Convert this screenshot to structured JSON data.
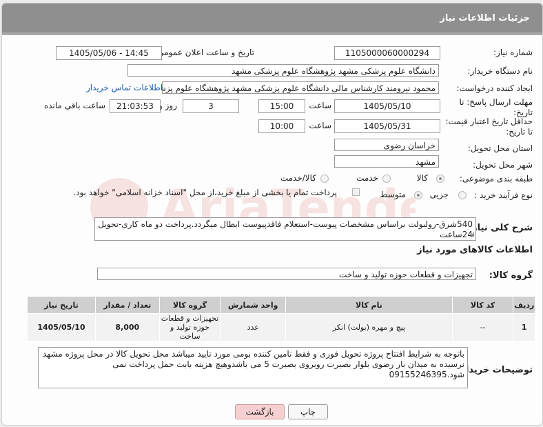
{
  "header": {
    "title": "جزئیات اطلاعات نیاز"
  },
  "fields": {
    "need_number_label": "شماره نیاز:",
    "need_number": "1105000060000294",
    "announce_label": "تاریخ و ساعت اعلان عمومی:",
    "announce_value": "1405/05/06 - 14:45",
    "buyer_org_label": "نام دستگاه خریدار:",
    "buyer_org": "دانشگاه علوم پزشکی مشهد   پژوهشگاه علوم پزشکی مشهد",
    "requester_label": "ایجاد کننده درخواست:",
    "requester": "محمود نیرومند کارشناس مالی دانشگاه علوم پزشکی مشهد   پژوهشگاه علوم پزشکی مشهد",
    "contact_link": "اطلاعات تماس خریدار",
    "deadline_label": "مهلت ارسال پاسخ: تا تاریخ:",
    "deadline_date": "1405/05/10",
    "time_label": "ساعت",
    "deadline_time": "15:00",
    "days_value": "3",
    "days_label": "روز و",
    "remaining_time": "21:03:53",
    "remaining_label": "ساعت باقی مانده",
    "validity_label": "حداقل تاریخ اعتبار قیمت: تا تاریخ:",
    "validity_date": "1405/05/31",
    "validity_time_label": "ساعت",
    "validity_time": "10:00",
    "province_label": "استان محل تحویل:",
    "province": "خراسان رضوی",
    "city_label": "شهر محل تحویل:",
    "city": "مشهد",
    "category_label": "طبقه بندی موضوعی:",
    "category_options": [
      "کالا",
      "خدمت",
      "کالا/خدمت"
    ],
    "category_selected": "کالا",
    "process_label": "نوع فرآیند خرید :",
    "process_options": [
      "جزیی",
      "متوسط"
    ],
    "process_selected": "جزیی",
    "payment_note": "پرداخت تمام یا بخشی از مبلغ خرید،از محل \"اسناد خزانه اسلامی\" خواهد بود."
  },
  "description": {
    "label": "شرح کلی نیاز:",
    "text": "540شرق-رولبولت براساس مشخصات پیوست-استعلام فاقدپیوست ابطال میگردد.پرداخت دو ماه کاری-تحویل 24ساعت"
  },
  "goods": {
    "section_title": "اطلاعات کالاهای مورد نیاز",
    "group_label": "گروه کالا:",
    "group_value": "تجهیزات و قطعات حوزه تولید و ساخت",
    "columns": [
      "ردیف",
      "کد کالا",
      "نام کالا",
      "واحد شمارش",
      "گروه کالا",
      "تعداد / مقدار",
      "تاریخ نیاز"
    ],
    "rows": [
      {
        "index": "1",
        "code": "--",
        "name": "پیچ و مهره (بولت) انکر",
        "unit": "عدد",
        "group": "تجهیزات و قطعات حوزه تولید و ساخت",
        "qty": "8,000",
        "date": "1405/05/10"
      }
    ]
  },
  "buyer_notes": {
    "label": "توضیحات خریدار:",
    "text": "باتوجه به شرایط افتتاح پروژه تحویل فوری و فقط تامین کننده بومی مورد تایید میباشد محل تحویل کالا در محل پروژه  مشهد نرسیده به میدان بار رضوی بلوار بصیرت روبروی بصیرت 5 می باشدوهیچ هزینه بابت حمل  پرداخت نمی شود.09155246395"
  },
  "buttons": {
    "print": "چاپ",
    "back": "بازگشت"
  },
  "colors": {
    "header_bg": "#8f8f8f",
    "link": "#1a5fb4",
    "back_button": "#f6d0d0"
  }
}
